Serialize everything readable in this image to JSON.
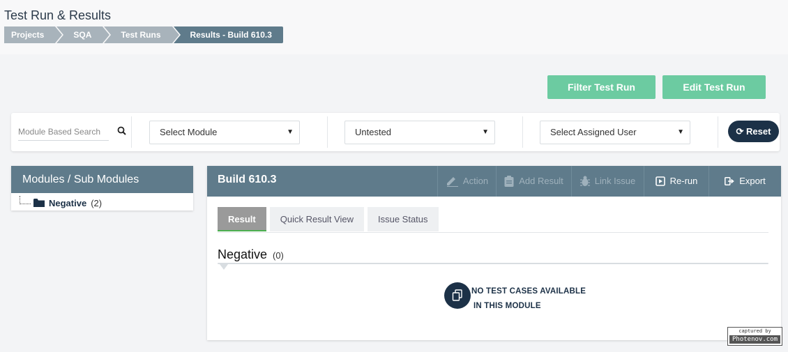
{
  "page": {
    "title": "Test Run & Results"
  },
  "breadcrumb": [
    "Projects",
    "SQA",
    "Test Runs",
    "Results - Build 610.3"
  ],
  "actions": {
    "filter_label": "Filter Test Run",
    "edit_label": "Edit Test Run"
  },
  "filters": {
    "search_placeholder": "Module Based Search",
    "module_value": "Select Module",
    "status_value": "Untested",
    "user_value": "Select Assigned User",
    "reset_label": "Reset"
  },
  "modules": {
    "title": "Modules / Sub Modules",
    "items": [
      {
        "label": "Negative",
        "count": "(2)"
      }
    ]
  },
  "build": {
    "title": "Build 610.3",
    "toolbar": {
      "action": "Action",
      "add_result": "Add Result",
      "link_issue": "Link Issue",
      "rerun": "Re-run",
      "export": "Export"
    },
    "tabs": [
      "Result",
      "Quick Result View",
      "Issue Status"
    ],
    "section": {
      "title": "Negative",
      "count": "(0)"
    },
    "empty": {
      "line1": "NO TEST CASES AVAILABLE",
      "line2": "IN THIS MODULE"
    }
  },
  "watermark": {
    "line1": "captured by",
    "line2": "Photenov.com"
  },
  "colors": {
    "header": "#5f7b8b",
    "accent": "#6ccba1",
    "navy": "#1c3147"
  }
}
